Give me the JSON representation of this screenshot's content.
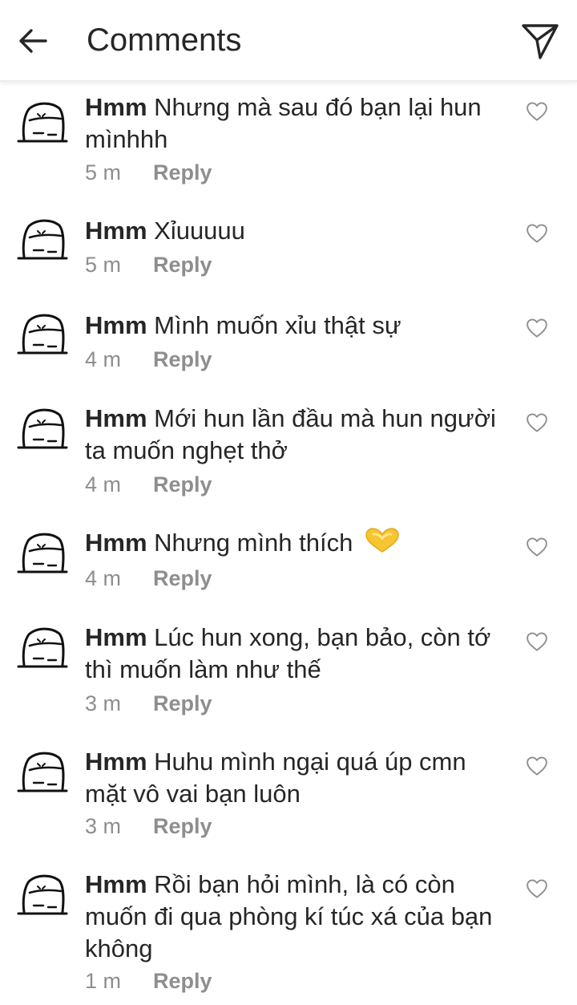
{
  "header": {
    "title": "Comments",
    "back_icon": "arrow-left-icon",
    "share_icon": "paper-plane-icon"
  },
  "colors": {
    "text": "#262626",
    "secondary": "#8e8e8e",
    "divider": "#ebebeb",
    "emoji": "#f7c531"
  },
  "comments": [
    {
      "username": "Hmm",
      "text": "Nhưng mà sau đó bạn lại hun mìnhhh",
      "time": "5 m",
      "reply": "Reply"
    },
    {
      "username": "Hmm",
      "text": "Xỉuuuuu",
      "time": "5 m",
      "reply": "Reply"
    },
    {
      "username": "Hmm",
      "text": "Mình muốn xỉu thật sự",
      "time": "4 m",
      "reply": "Reply"
    },
    {
      "username": "Hmm",
      "text": "Mới hun lần đầu mà hun người ta muốn nghẹt thở",
      "time": "4 m",
      "reply": "Reply"
    },
    {
      "username": "Hmm",
      "text": "Nhưng mình thích",
      "emoji": "heart-hands-emoji",
      "time": "4 m",
      "reply": "Reply"
    },
    {
      "username": "Hmm",
      "text": "Lúc hun xong, bạn bảo, còn tớ thì muốn làm như thế",
      "time": "3 m",
      "reply": "Reply"
    },
    {
      "username": "Hmm",
      "text": "Huhu mình ngại quá úp cmn mặt vô vai bạn luôn",
      "time": "3 m",
      "reply": "Reply"
    },
    {
      "username": "Hmm",
      "text": "Rồi bạn hỏi mình, là có còn muốn đi qua phòng kí túc xá của bạn không",
      "time": "1 m",
      "reply": "Reply"
    }
  ]
}
